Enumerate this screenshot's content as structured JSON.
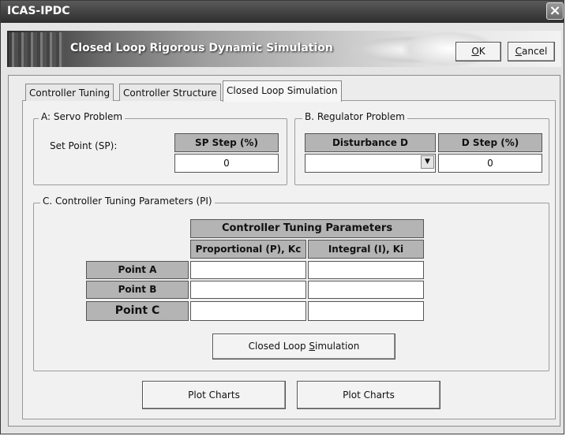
{
  "window": {
    "title": "ICAS-IPDC",
    "close_glyph": "×"
  },
  "banner": {
    "title": "Closed Loop Rigorous Dynamic Simulation"
  },
  "buttons": {
    "ok": {
      "mnemonic": "O",
      "rest": "K"
    },
    "cancel": {
      "mnemonic": "C",
      "rest": "ancel"
    }
  },
  "tabs": [
    {
      "label": "Controller Tuning"
    },
    {
      "label": "Controller Structure"
    },
    {
      "label": "Closed Loop Simulation"
    }
  ],
  "servo": {
    "legend": "A: Servo Problem",
    "label": "Set Point (SP):",
    "header": "SP Step (%)",
    "value": "0"
  },
  "regulator": {
    "legend": "B. Regulator Problem",
    "disturbance_header": "Disturbance D",
    "disturbance_value": "",
    "step_header": "D Step (%)",
    "step_value": "0",
    "dropdown_icon": "chevron-down-icon"
  },
  "tuning": {
    "legend": "C. Controller Tuning Parameters (PI)",
    "group_header": "Controller Tuning Parameters",
    "col_headers": [
      "Proportional (P), Kc",
      "Integral (I), Ki"
    ],
    "rows": [
      {
        "label": "Point A",
        "kc": "",
        "ki": ""
      },
      {
        "label": "Point B",
        "kc": "",
        "ki": ""
      },
      {
        "label": "Point C",
        "kc": "",
        "ki": ""
      }
    ]
  },
  "simulate_button": {
    "before": "Closed Loop ",
    "mnemonic": "S",
    "after": "imulation"
  },
  "plot_buttons": [
    {
      "label": "Plot Charts"
    },
    {
      "label": "Plot Charts"
    }
  ]
}
